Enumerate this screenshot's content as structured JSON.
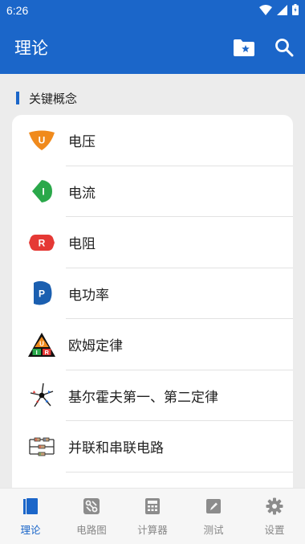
{
  "status": {
    "time": "6:26"
  },
  "app": {
    "title": "理论"
  },
  "section": {
    "title": "关键概念"
  },
  "items": [
    {
      "label": "电压",
      "icon": "voltage-icon",
      "letter": "U"
    },
    {
      "label": "电流",
      "icon": "current-icon",
      "letter": "I"
    },
    {
      "label": "电阻",
      "icon": "resistance-icon",
      "letter": "R"
    },
    {
      "label": "电功率",
      "icon": "power-icon",
      "letter": "P"
    },
    {
      "label": "欧姆定律",
      "icon": "ohms-law-triangle-icon",
      "letters": [
        "U",
        "I",
        "R"
      ]
    },
    {
      "label": "基尔霍夫第一、第二定律",
      "icon": "kirchhoff-node-icon"
    },
    {
      "label": "并联和串联电路",
      "icon": "series-parallel-circuit-icon"
    }
  ],
  "nav": [
    {
      "label": "理论",
      "icon": "book-icon",
      "active": true
    },
    {
      "label": "电路图",
      "icon": "circuit-diagram-icon",
      "active": false
    },
    {
      "label": "计算器",
      "icon": "calculator-icon",
      "active": false
    },
    {
      "label": "测试",
      "icon": "test-icon",
      "active": false
    },
    {
      "label": "设置",
      "icon": "gear-icon",
      "active": false
    }
  ],
  "colors": {
    "primary": "#1b66c9",
    "voltage": "#f08a1c",
    "current": "#2aa84a",
    "resistance": "#e53935",
    "power": "#1b5fb0",
    "nav_inactive": "#888888"
  }
}
